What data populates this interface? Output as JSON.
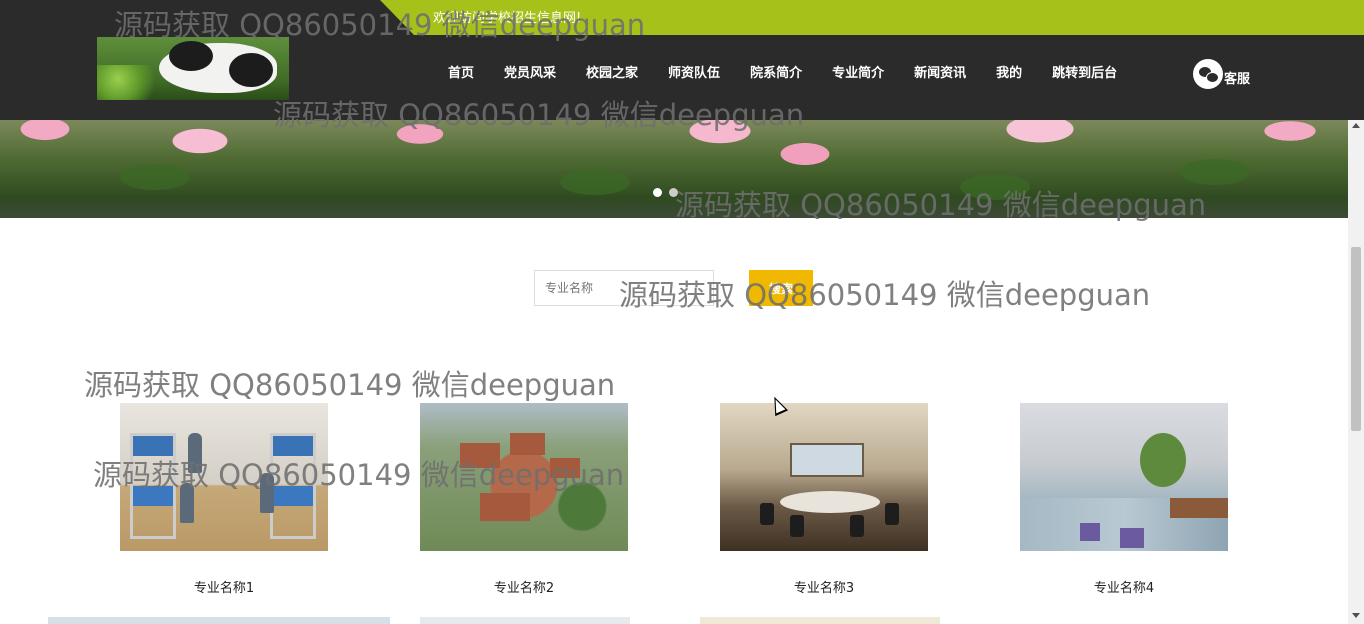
{
  "header": {
    "welcome_text": "欢迎访问学校招生信息网!",
    "nav": [
      {
        "label": "首页"
      },
      {
        "label": "党员风采"
      },
      {
        "label": "校园之家"
      },
      {
        "label": "师资队伍"
      },
      {
        "label": "院系简介"
      },
      {
        "label": "专业简介"
      },
      {
        "label": "新闻资讯"
      },
      {
        "label": "我的"
      },
      {
        "label": "跳转到后台"
      }
    ],
    "service_label": "客服",
    "logo_icon": "panda-logo-icon",
    "service_icon": "wechat-icon"
  },
  "banner": {
    "slide_count": 2,
    "active_slide": 1
  },
  "search": {
    "placeholder": "专业名称",
    "button_label": "搜索"
  },
  "majors": [
    {
      "title": "专业名称1"
    },
    {
      "title": "专业名称2"
    },
    {
      "title": "专业名称3"
    },
    {
      "title": "专业名称4"
    }
  ],
  "watermarks": [
    "源码获取 QQ86050149 微信deepguan",
    "源码获取 QQ86050149 微信deepguan",
    "源码获取 QQ86050149 微信deepguan",
    "源码获取 QQ86050149 微信deepguan",
    "源码获取 QQ86050149 微信deepguan",
    "源码获取 QQ86050149 微信deepguan"
  ],
  "colors": {
    "topbar": "#2b2b2b",
    "accent_green": "#a6c21a",
    "search_button": "#f0b800"
  }
}
